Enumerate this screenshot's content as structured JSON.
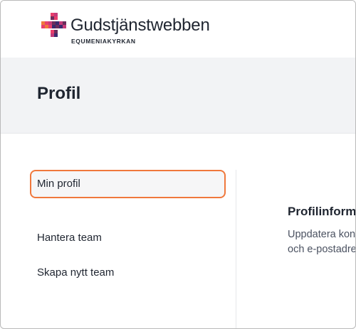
{
  "brand": {
    "name": "Gudstjänstwebben",
    "subtitle": "EQUMENIAKYRKAN",
    "logo_icon": "cross-mosaic-icon",
    "colors": [
      "#e83e6c",
      "#f0783c",
      "#6b2d5c",
      "#3a2a6e",
      "#c43b7a"
    ]
  },
  "page": {
    "title": "Profil"
  },
  "sidebar": {
    "items": [
      {
        "label": "Min profil",
        "active": true
      },
      {
        "label": "Hantera team",
        "active": false
      },
      {
        "label": "Skapa nytt team",
        "active": false
      }
    ]
  },
  "main": {
    "section_title": "Profilinformation",
    "section_desc_line1": "Uppdatera kontots profilinformation",
    "section_desc_line2": "och e-postadress."
  },
  "colors": {
    "accent": "#f0783c",
    "text": "#1f2530",
    "header_bg": "#f2f3f5"
  }
}
